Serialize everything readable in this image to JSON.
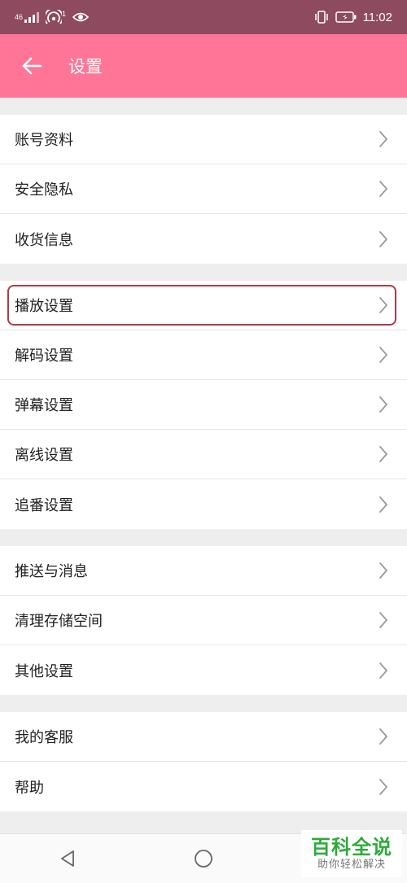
{
  "status_bar": {
    "signal_text": "46",
    "wifi_badge": "1",
    "time": "11:02"
  },
  "header": {
    "title": "设置"
  },
  "groups": [
    {
      "items": [
        "账号资料",
        "安全隐私",
        "收货信息"
      ]
    },
    {
      "items": [
        "播放设置",
        "解码设置",
        "弹幕设置",
        "离线设置",
        "追番设置"
      ]
    },
    {
      "items": [
        "推送与消息",
        "清理存储空间",
        "其他设置"
      ]
    },
    {
      "items": [
        "我的客服",
        "帮助"
      ]
    }
  ],
  "highlighted_item": "播放设置",
  "watermark": {
    "main": "百科全说",
    "sub": "助你轻松解决"
  },
  "colors": {
    "status_bar": "#8e4a5e",
    "header": "#ff7597",
    "highlight_border": "#b03a48",
    "watermark_green": "#2eaa3a"
  },
  "icons": {
    "back": "arrow-left-icon",
    "row": "chevron-right-icon",
    "nav_back": "triangle-back-icon",
    "nav_home": "circle-home-icon",
    "nav_recent": "square-recent-icon"
  }
}
